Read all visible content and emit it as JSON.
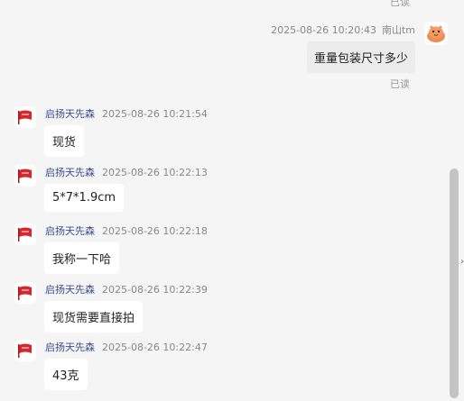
{
  "top_partial_read": "已读",
  "outgoing": {
    "timestamp": "2025-08-26 10:20:43",
    "sender": "南山tm",
    "text": "重量包装尺寸多少",
    "read_status": "已读",
    "avatar_icon": "cartoon-avatar-icon"
  },
  "incoming": [
    {
      "sender": "启扬天先森",
      "timestamp": "2025-08-26 10:21:54",
      "text": "现货"
    },
    {
      "sender": "启扬天先森",
      "timestamp": "2025-08-26 10:22:13",
      "text": "5*7*1.9cm"
    },
    {
      "sender": "启扬天先森",
      "timestamp": "2025-08-26 10:22:18",
      "text": "我称一下哈"
    },
    {
      "sender": "启扬天先森",
      "timestamp": "2025-08-26 10:22:39",
      "text": "现货需要直接拍"
    },
    {
      "sender": "启扬天先森",
      "timestamp": "2025-08-26 10:22:47",
      "text": "43克"
    }
  ],
  "colors": {
    "background": "#f5f5f5",
    "incoming_bubble": "#ffffff",
    "outgoing_bubble": "#ececec",
    "sender_name": "#3a4d8f",
    "flag_red": "#d8262b"
  },
  "icons": {
    "incoming_avatar": "red-flag-logo-icon",
    "scroll_arrow": "chevron-right-icon"
  }
}
